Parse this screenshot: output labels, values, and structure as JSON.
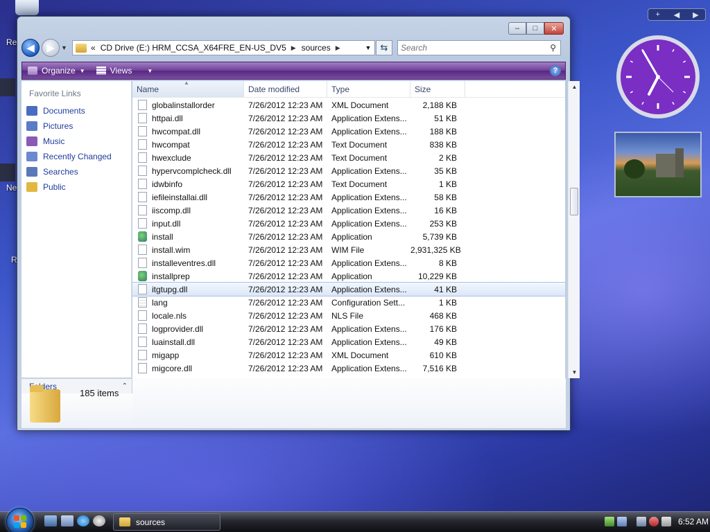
{
  "desktop": {
    "labels": [
      "Re",
      "Ne",
      "R"
    ]
  },
  "window": {
    "caption": {
      "minimize": "–",
      "maximize": "□",
      "close": "✕"
    },
    "nav": {
      "back_glyph": "◀",
      "fwd_glyph": "▶",
      "history_glyph": "▼",
      "address": {
        "overflow": "«",
        "segments": [
          "CD Drive (E:) HRM_CCSA_X64FRE_EN-US_DV5",
          "sources"
        ],
        "separator": "▶",
        "dropdown": "▼"
      },
      "refresh_glyph": "⇆",
      "search_placeholder": "Search",
      "search_glyph": "⚲"
    },
    "toolbar": {
      "organize": "Organize",
      "views": "Views",
      "help": "?"
    },
    "nav_pane": {
      "header": "Favorite Links",
      "links": [
        {
          "label": "Documents",
          "color": "#4a6cc2"
        },
        {
          "label": "Pictures",
          "color": "#5a7cc6"
        },
        {
          "label": "Music",
          "color": "#8a5ab5"
        },
        {
          "label": "Recently Changed",
          "color": "#6b8ad0"
        },
        {
          "label": "Searches",
          "color": "#5b78b8"
        },
        {
          "label": "Public",
          "color": "#e2b741"
        }
      ],
      "folders_label": "Folders",
      "folders_chevron": "⌃"
    },
    "columns": {
      "name": "Name",
      "date": "Date modified",
      "type": "Type",
      "size": "Size"
    },
    "rows": [
      {
        "name": "globalinstallorder",
        "date": "7/26/2012 12:23 AM",
        "type": "XML Document",
        "size": "2,188 KB",
        "icon": "doc"
      },
      {
        "name": "httpai.dll",
        "date": "7/26/2012 12:23 AM",
        "type": "Application Extens...",
        "size": "51 KB",
        "icon": "doc"
      },
      {
        "name": "hwcompat.dll",
        "date": "7/26/2012 12:23 AM",
        "type": "Application Extens...",
        "size": "188 KB",
        "icon": "doc"
      },
      {
        "name": "hwcompat",
        "date": "7/26/2012 12:23 AM",
        "type": "Text Document",
        "size": "838 KB",
        "icon": "doc"
      },
      {
        "name": "hwexclude",
        "date": "7/26/2012 12:23 AM",
        "type": "Text Document",
        "size": "2 KB",
        "icon": "doc"
      },
      {
        "name": "hypervcomplcheck.dll",
        "date": "7/26/2012 12:23 AM",
        "type": "Application Extens...",
        "size": "35 KB",
        "icon": "doc"
      },
      {
        "name": "idwbinfo",
        "date": "7/26/2012 12:23 AM",
        "type": "Text Document",
        "size": "1 KB",
        "icon": "doc"
      },
      {
        "name": "iefileinstallai.dll",
        "date": "7/26/2012 12:23 AM",
        "type": "Application Extens...",
        "size": "58 KB",
        "icon": "doc"
      },
      {
        "name": "iiscomp.dll",
        "date": "7/26/2012 12:23 AM",
        "type": "Application Extens...",
        "size": "16 KB",
        "icon": "doc"
      },
      {
        "name": "input.dll",
        "date": "7/26/2012 12:23 AM",
        "type": "Application Extens...",
        "size": "253 KB",
        "icon": "doc"
      },
      {
        "name": "install",
        "date": "7/26/2012 12:23 AM",
        "type": "Application",
        "size": "5,739 KB",
        "icon": "app"
      },
      {
        "name": "install.wim",
        "date": "7/26/2012 12:23 AM",
        "type": "WIM File",
        "size": "2,931,325 KB",
        "icon": "doc"
      },
      {
        "name": "installeventres.dll",
        "date": "7/26/2012 12:23 AM",
        "type": "Application Extens...",
        "size": "8 KB",
        "icon": "doc"
      },
      {
        "name": "installprep",
        "date": "7/26/2012 12:23 AM",
        "type": "Application",
        "size": "10,229 KB",
        "icon": "app"
      },
      {
        "name": "itgtupg.dll",
        "date": "7/26/2012 12:23 AM",
        "type": "Application Extens...",
        "size": "41 KB",
        "icon": "doc",
        "selected": true
      },
      {
        "name": "lang",
        "date": "7/26/2012 12:23 AM",
        "type": "Configuration Sett...",
        "size": "1 KB",
        "icon": "cfg"
      },
      {
        "name": "locale.nls",
        "date": "7/26/2012 12:23 AM",
        "type": "NLS File",
        "size": "468 KB",
        "icon": "doc"
      },
      {
        "name": "logprovider.dll",
        "date": "7/26/2012 12:23 AM",
        "type": "Application Extens...",
        "size": "176 KB",
        "icon": "doc"
      },
      {
        "name": "luainstall.dll",
        "date": "7/26/2012 12:23 AM",
        "type": "Application Extens...",
        "size": "49 KB",
        "icon": "doc"
      },
      {
        "name": "migapp",
        "date": "7/26/2012 12:23 AM",
        "type": "XML Document",
        "size": "610 KB",
        "icon": "doc"
      },
      {
        "name": "migcore.dll",
        "date": "7/26/2012 12:23 AM",
        "type": "Application Extens...",
        "size": "7,516 KB",
        "icon": "doc"
      }
    ],
    "scroll": {
      "up": "▲",
      "down": "▼"
    },
    "details": {
      "item_count": "185 items"
    }
  },
  "gadgets": {
    "controls": [
      "+",
      "◀",
      "▶"
    ]
  },
  "taskbar": {
    "task_label": "sources",
    "time": "6:52 AM"
  },
  "colors": {
    "toolbar": "#6e3e98",
    "link": "#1f3d9c",
    "clock_face": "#7a2ec4"
  }
}
